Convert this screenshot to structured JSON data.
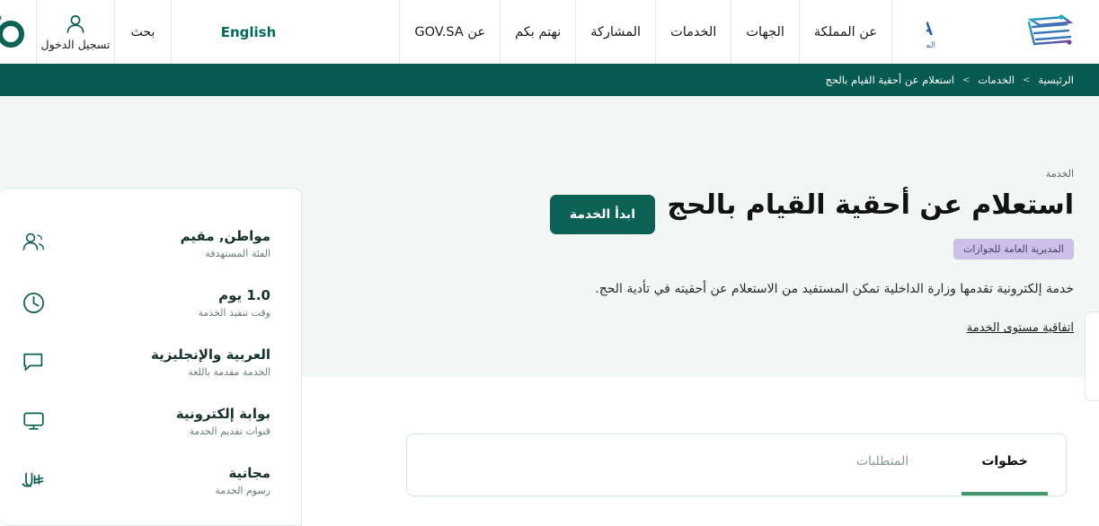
{
  "header": {
    "logo": {
      "name": "GOV.SA",
      "tagline": "المنصة الوطنية الموحدة"
    },
    "nav_items": [
      {
        "label": "عن المملكة"
      },
      {
        "label": "الجهات"
      },
      {
        "label": "الخدمات"
      },
      {
        "label": "المشاركة"
      },
      {
        "label": "نهتم بكم"
      },
      {
        "label": "عن GOV.SA"
      }
    ],
    "language_toggle": "English",
    "search_label": "بحث",
    "login_label": "تسجيل الدخول"
  },
  "breadcrumb": {
    "home": "الرئيسية",
    "separator": ">",
    "section": "الخدمات",
    "current": "استعلام عن أحقية القيام بالحج"
  },
  "hero": {
    "kicker": "الخدمة",
    "title": "استعلام عن أحقية القيام بالحج",
    "provider_badge": "المديرية العامة للجوازات",
    "description": "خدمة إلكترونية تقدمها وزارة الداخلية تمكن المستفيد من الاستعلام عن أحقيته في تأدية الحج.",
    "sla_link": "اتفاقية مستوى الخدمة",
    "start_button": "ابدأ الخدمة"
  },
  "info_card": {
    "rows": [
      {
        "icon": "users-icon",
        "value": "مواطن, مقيم",
        "label": "الفئة المستهدفة"
      },
      {
        "icon": "clock-icon",
        "value": "1.0 يوم",
        "label": "وقت تنفيذ الخدمة"
      },
      {
        "icon": "speech-bubble-icon",
        "value": "العربية والإنجليزية",
        "label": "الخدمة مقدمة باللغة"
      },
      {
        "icon": "monitor-icon",
        "value": "بوابة إلكترونية",
        "label": "قنوات تقديم الخدمة"
      },
      {
        "icon": "riyal-currency-icon",
        "value": "مجانية",
        "label": "رسوم الخدمة"
      }
    ]
  },
  "tabs": {
    "items": [
      {
        "label": "خطوات",
        "active": true
      },
      {
        "label": "المتطلبات",
        "active": false
      }
    ]
  },
  "colors": {
    "brand_green": "#0b6153",
    "breadcrumb_bar": "#065a50",
    "hero_bg": "#f2f7f5",
    "badge_bg": "#cdc0e8",
    "badge_text": "#4a3c6e",
    "tab_underline": "#41976d"
  }
}
